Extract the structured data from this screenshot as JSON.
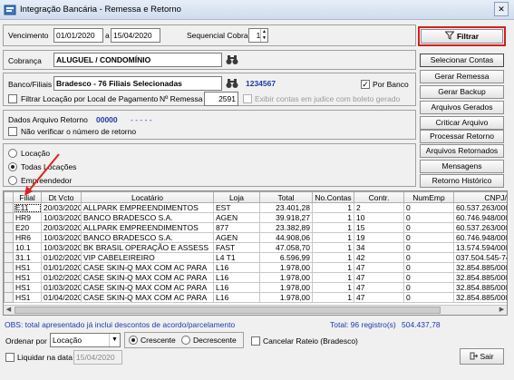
{
  "window": {
    "title": "Integração Bancária - Remessa e Retorno"
  },
  "filters": {
    "vencimento_label": "Vencimento",
    "date_from": "01/01/2020",
    "date_sep": "a",
    "date_to": "15/04/2020",
    "sequencial_label": "Sequencial Cobrança",
    "sequencial_value": "1",
    "filtrar_label": "Filtrar",
    "cobranca_label": "Cobrança",
    "cobranca_value": "ALUGUEL / CONDOMÍNIO",
    "banco_label": "Banco/Filiais",
    "banco_value": "Bradesco - 76 Filiais Selecionadas",
    "banco_code": "1234567",
    "por_banco_label": "Por Banco",
    "por_banco_checked": "✓",
    "filtrar_locacao_label": "Filtrar Locação por Local de Pagamento",
    "n_remessa_label": "Nº Remessa",
    "n_remessa_value": "2591",
    "exibir_contas_label": "Exibir contas em judice com boleto gerado",
    "dados_retorno_label": "Dados Arquivo Retorno",
    "dados_retorno_value": "00000",
    "dados_retorno_dashes": "- - - - -",
    "nao_verificar_label": "Não verificar o número de retorno",
    "radio_locacao": "Locação",
    "radio_todas": "Todas Locações",
    "radio_empreendedor": "Empreendedor"
  },
  "actions": {
    "selecionar_contas": "Selecionar Contas",
    "gerar_remessa": "Gerar Remessa",
    "gerar_backup": "Gerar Backup",
    "arquivos_gerados": "Arquivos Gerados",
    "criticar_arquivo": "Criticar Arquivo",
    "processar_retorno": "Processar Retorno",
    "arquivos_retornados": "Arquivos Retornados",
    "mensagens": "Mensagens",
    "retorno_historico": "Retorno Histórico"
  },
  "table": {
    "columns": [
      "",
      "Filial",
      "Dt Vcto",
      "Locatário",
      "Loja",
      "Total",
      "No.Contas",
      "Contr.",
      "NumEmp",
      "CNPJ/CE"
    ],
    "rows": [
      [
        "E11",
        "20/03/2020",
        "ALLPARK EMPREENDIMENTOS",
        "EST",
        "23.401,28",
        "1",
        "2",
        "0",
        "60.537.263/000"
      ],
      [
        "HR9",
        "10/03/2020",
        "BANCO BRADESCO S.A.",
        "AGEN",
        "39.918,27",
        "1",
        "10",
        "0",
        "60.746.948/000"
      ],
      [
        "E20",
        "20/03/2020",
        "ALLPARK EMPREENDIMENTOS",
        "877",
        "23.382,89",
        "1",
        "15",
        "0",
        "60.537.263/000"
      ],
      [
        "HR6",
        "10/03/2020",
        "BANCO BRADESCO S.A.",
        "AGEN",
        "44.908,06",
        "1",
        "19",
        "0",
        "60.746.948/000"
      ],
      [
        "10.1",
        "10/03/2020",
        "BK BRASIL OPERAÇÃO E ASSESS",
        "FAST",
        "47.058,70",
        "1",
        "34",
        "0",
        "13.574.594/000"
      ],
      [
        "31.1",
        "01/02/2020",
        "VIP CABELEIREIRO",
        "L4 T1",
        "6.596,99",
        "1",
        "42",
        "0",
        "037.504.545-74"
      ],
      [
        "HS1",
        "01/01/2020",
        "CASE SKIN-Q MAX COM AC PARA",
        "L16",
        "1.978,00",
        "1",
        "47",
        "0",
        "32.854.885/000"
      ],
      [
        "HS1",
        "01/02/2020",
        "CASE SKIN-Q MAX COM AC PARA",
        "L16",
        "1.978,00",
        "1",
        "47",
        "0",
        "32.854.885/000"
      ],
      [
        "HS1",
        "01/03/2020",
        "CASE SKIN-Q MAX COM AC PARA",
        "L16",
        "1.978,00",
        "1",
        "47",
        "0",
        "32.854.885/000"
      ],
      [
        "HS1",
        "01/04/2020",
        "CASE SKIN-Q MAX COM AC PARA",
        "L16",
        "1.978,00",
        "1",
        "47",
        "0",
        "32.854.885/000"
      ]
    ]
  },
  "footer": {
    "obs": "OBS: total apresentado já inclui descontos de acordo/parcelamento",
    "total_label": "Total: 96 registro(s)",
    "total_value": "504.437,78",
    "ordenar_label": "Ordenar por",
    "ordenar_value": "Locação",
    "crescente": "Crescente",
    "decrescente": "Decrescente",
    "cancelar_rateio": "Cancelar Rateio (Bradesco)",
    "liquidar_label": "Liquidar na data",
    "liquidar_value": "15/04/2020",
    "sair": "Sair"
  },
  "colors": {
    "blue_text": "#1d3aa8",
    "highlight_border": "#d42020",
    "arrow": "#e02020"
  },
  "icons": [
    "app-icon",
    "filter-icon",
    "binoculars-icon",
    "exit-icon"
  ]
}
